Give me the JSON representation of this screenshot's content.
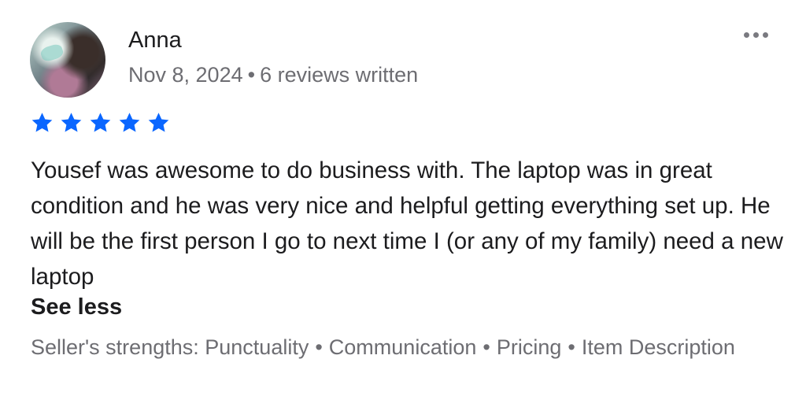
{
  "reviewer": {
    "name": "Anna",
    "date": "Nov 8, 2024",
    "separator": "•",
    "reviews_count": "6 reviews written"
  },
  "rating": {
    "stars": 5,
    "max": 5,
    "color": "#0a66ff"
  },
  "menu": {
    "icon": "more-horizontal-icon"
  },
  "review": {
    "text": "Yousef was awesome to do business with. The laptop was in great condition and he was very nice and helpful getting everything set up. He will be the first person I go to next time I (or any of my family) need a new laptop",
    "toggle_label": "See less"
  },
  "strengths": {
    "prefix": "Seller's strengths:",
    "items": [
      "Punctuality",
      "Communication",
      "Pricing",
      "Item Description"
    ],
    "separator": "•"
  }
}
